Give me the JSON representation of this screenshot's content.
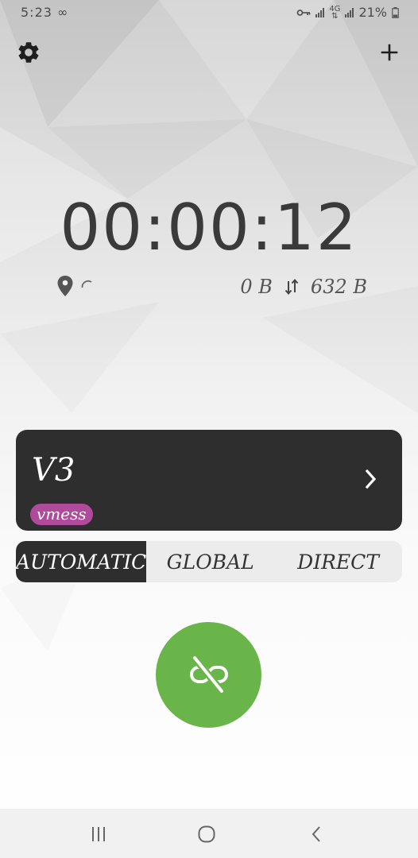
{
  "status": {
    "time": "5:23",
    "infinity": "∞",
    "network_type": "4G",
    "battery": "21%"
  },
  "header": {
    "settings_icon": "gear-icon",
    "add_icon": "plus-icon"
  },
  "timer": {
    "elapsed": "00:00:12"
  },
  "stats": {
    "download": "0 B",
    "upload": "632 B"
  },
  "server": {
    "name": "V3",
    "protocol": "vmess"
  },
  "modes": {
    "automatic": "AUTOMATIC",
    "global": "GLOBAL",
    "direct": "DIRECT",
    "selected": "AUTOMATIC"
  },
  "connect": {
    "icon": "link-off-icon",
    "color": "#6ab54a"
  },
  "colors": {
    "card": "#2e2e2e",
    "badge": "#b04a9b",
    "accent_green": "#6ab54a"
  }
}
